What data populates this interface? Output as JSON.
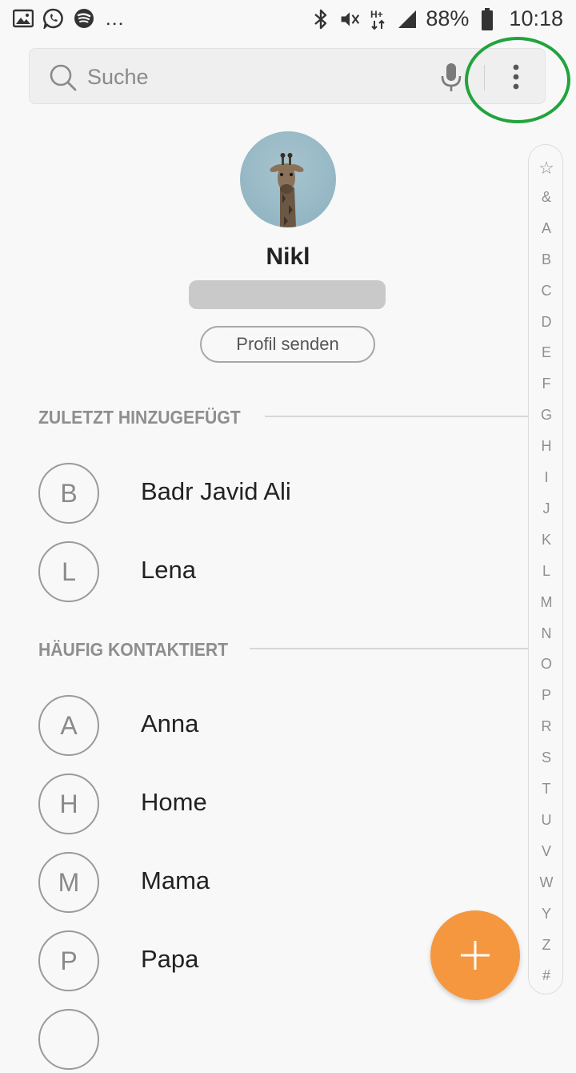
{
  "status_bar": {
    "left_icons": [
      "gallery-icon",
      "whatsapp-icon",
      "spotify-icon"
    ],
    "more_dots": "...",
    "right_icons": [
      "bluetooth-icon",
      "vibrate-mute-icon",
      "data-hplus-icon",
      "signal-icon",
      "battery-icon"
    ],
    "battery": "88%",
    "time": "10:18"
  },
  "search": {
    "placeholder": "Suche"
  },
  "profile": {
    "name": "Nikl",
    "send_button": "Profil senden"
  },
  "sections": [
    {
      "title": "ZULETZT HINZUGEFÜGT",
      "contacts": [
        {
          "initial": "B",
          "name": "Badr Javid Ali"
        },
        {
          "initial": "L",
          "name": "Lena"
        }
      ]
    },
    {
      "title": "HÄUFIG KONTAKTIERT",
      "contacts": [
        {
          "initial": "A",
          "name": "Anna"
        },
        {
          "initial": "H",
          "name": "Home"
        },
        {
          "initial": "M",
          "name": "Mama"
        },
        {
          "initial": "P",
          "name": "Papa"
        }
      ]
    }
  ],
  "index_letters": [
    "☆",
    "&",
    "A",
    "B",
    "C",
    "D",
    "E",
    "F",
    "G",
    "H",
    "I",
    "J",
    "K",
    "L",
    "M",
    "N",
    "O",
    "P",
    "R",
    "S",
    "T",
    "U",
    "V",
    "W",
    "Y",
    "Z",
    "#"
  ],
  "colors": {
    "accent": "#f4973f",
    "highlight": "#21a33d",
    "section_text": "#8e8e8e"
  }
}
